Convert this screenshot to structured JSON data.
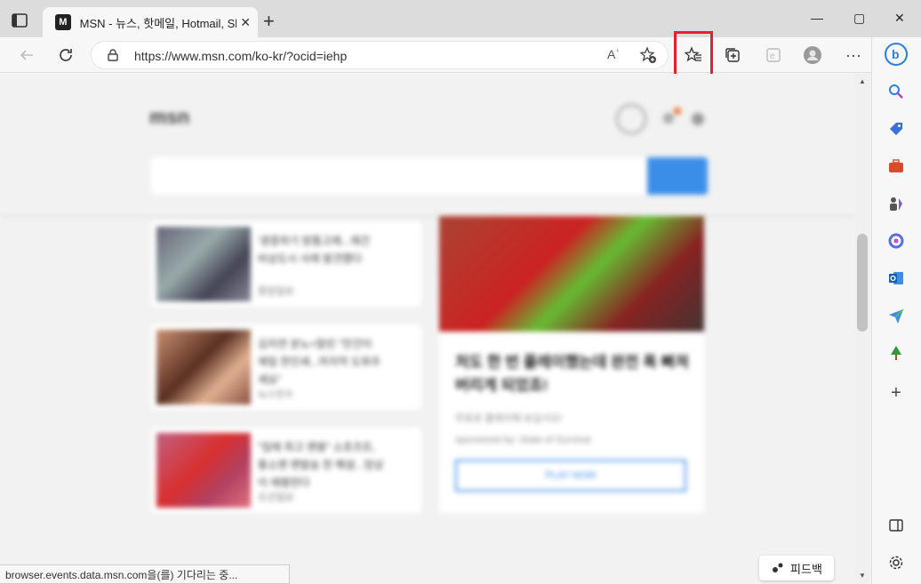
{
  "tab": {
    "title": "MSN - 뉴스, 핫메일, Hotmail, Sky",
    "close_label": "✕",
    "new_tab_label": "+"
  },
  "window": {
    "minimize": "—",
    "maximize": "▢",
    "close": "✕"
  },
  "addressbar": {
    "url": "https://www.msn.com/ko-kr/?ocid=iehp",
    "read_aloud": "Aʾ"
  },
  "toolbar": {
    "more": "···"
  },
  "content": {
    "logo": "msn",
    "cards": [
      {
        "lines": [
          "'경증하기 방통고례...재건",
          "비상도시 사례 발견했다"
        ],
        "source": "중앙일보"
      },
      {
        "lines": [
          "김지연 분노+말린 \"안건이",
          "제일 한인세...마지막 도와주",
          "세요\""
        ],
        "source": "뉴스민수"
      },
      {
        "lines": [
          "\"집에 최고 맨봉\" 소포츠트,",
          "통소맨 맨발송 한 해설...망상",
          "이 애평한다"
        ],
        "source": "조선일보"
      }
    ],
    "ad": {
      "headline": "처도 한 번 플레이했는데 완전 폭 빠져버리게 되었죠!",
      "sub1": "무료로 플레이해 보십시오!",
      "sub2": "sponsored by: State of Survival",
      "cta": "PLAY NOW"
    }
  },
  "statusbar": {
    "text": "browser.events.data.msn.com을(를) 기다리는 중..."
  },
  "feedback": {
    "label": "피드백"
  },
  "colors": {
    "highlight": "#e8202a",
    "accent": "#3b8ee8"
  }
}
